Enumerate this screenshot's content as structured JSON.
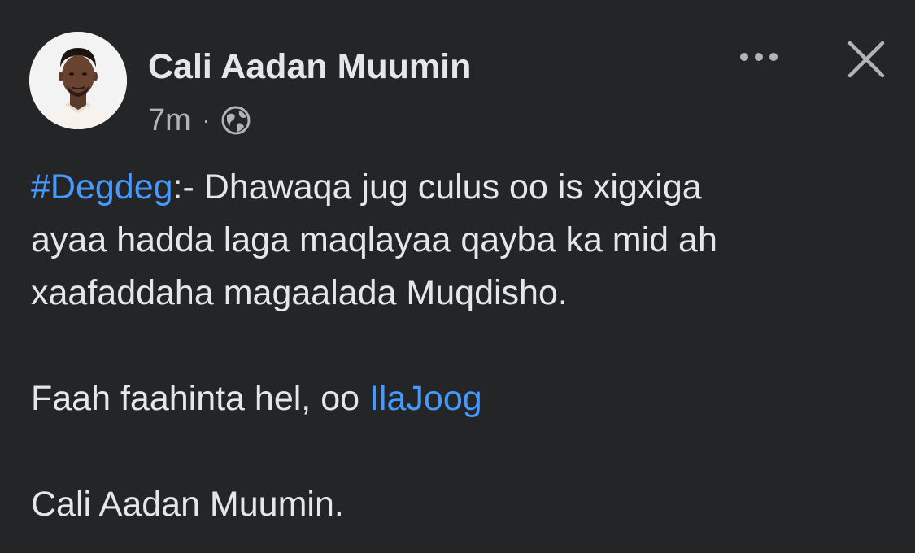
{
  "post": {
    "author_name": "Cali Aadan Muumin",
    "timestamp": "7m",
    "separator": "·",
    "privacy_icon": "globe-icon",
    "hashtag": "#Degdeg",
    "line1_rest": ":- Dhawaqa jug culus oo is xigxiga",
    "line2": "ayaa hadda laga maqlayaa qayba ka mid ah",
    "line3": "xaafaddaha magaalada Muqdisho.",
    "line4_prefix": "Faah faahinta hel, oo ",
    "line4_link": "IlaJoog",
    "signature": "Cali Aadan Muumin."
  },
  "header_actions": {
    "more_icon": "more-horizontal-icon",
    "close_icon": "close-icon"
  },
  "colors": {
    "background": "#242526",
    "primary_text": "#e4e6eb",
    "secondary_text": "#b0b3b8",
    "link": "#4599ff"
  }
}
